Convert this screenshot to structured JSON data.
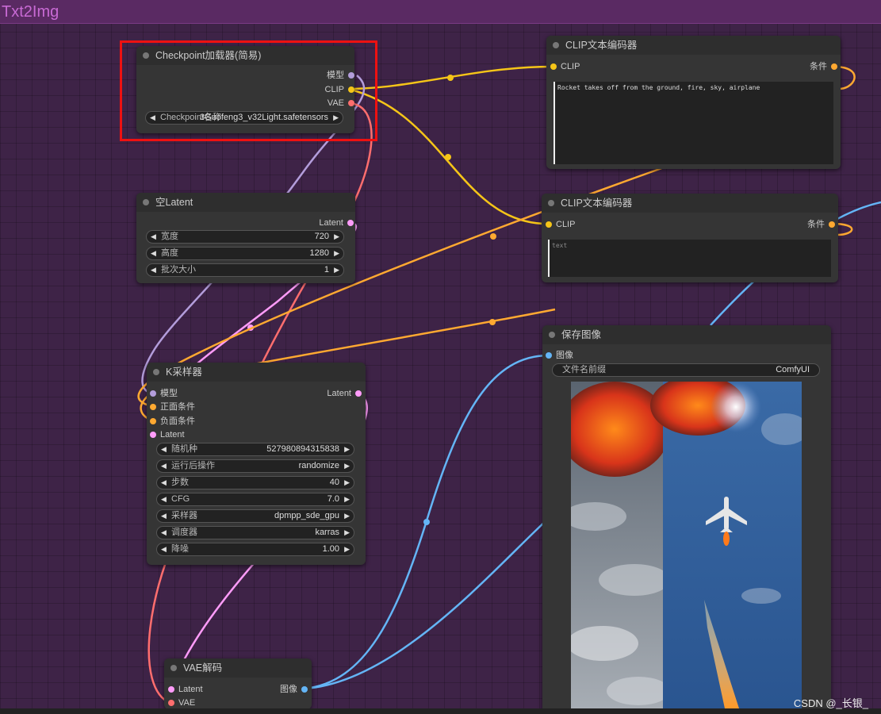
{
  "group": {
    "title": "Txt2Img"
  },
  "colors": {
    "clip": "#f5c518",
    "model": "#b39ddb",
    "vae": "#ff6e6e",
    "latent": "#ff9cf9",
    "conditioning": "#ffa931",
    "image": "#64b5f6"
  },
  "checkpoint": {
    "title": "Checkpoint加载器(简易)",
    "outputs": [
      "模型",
      "CLIP",
      "VAE"
    ],
    "widget_label": "Checkpoint名称",
    "widget_value": "3Guofeng3_v32Light.safetensors"
  },
  "clip_pos": {
    "title": "CLIP文本编码器",
    "input": "CLIP",
    "output": "条件",
    "text": "Rocket takes off from the ground, fire, sky, airplane"
  },
  "clip_neg": {
    "title": "CLIP文本编码器",
    "input": "CLIP",
    "output": "条件",
    "placeholder": "text"
  },
  "empty_latent": {
    "title": "空Latent",
    "output": "Latent",
    "widgets": [
      {
        "label": "宽度",
        "value": "720"
      },
      {
        "label": "高度",
        "value": "1280"
      },
      {
        "label": "批次大小",
        "value": "1"
      }
    ]
  },
  "ksampler": {
    "title": "K采样器",
    "inputs": [
      "模型",
      "正面条件",
      "负面条件",
      "Latent"
    ],
    "output": "Latent",
    "widgets": [
      {
        "label": "随机种",
        "value": "527980894315838"
      },
      {
        "label": "运行后操作",
        "value": "randomize"
      },
      {
        "label": "步数",
        "value": "40"
      },
      {
        "label": "CFG",
        "value": "7.0"
      },
      {
        "label": "采样器",
        "value": "dpmpp_sde_gpu"
      },
      {
        "label": "调度器",
        "value": "karras"
      },
      {
        "label": "降噪",
        "value": "1.00"
      }
    ]
  },
  "save_image": {
    "title": "保存图像",
    "input": "图像",
    "widget_label": "文件名前缀",
    "widget_value": "ComfyUI"
  },
  "vae_decode": {
    "title": "VAE解码",
    "inputs": [
      "Latent",
      "VAE"
    ],
    "output": "图像"
  },
  "watermark": "CSDN @_长银_"
}
